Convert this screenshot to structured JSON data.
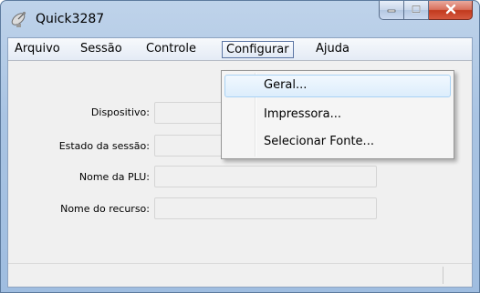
{
  "window": {
    "title": "Quick3287",
    "icon": "satellite-dish-icon",
    "buttons": {
      "minimize": "minimize-icon",
      "maximize": "maximize-icon",
      "close": "close-icon"
    }
  },
  "menubar": {
    "items": [
      {
        "label": "Arquivo"
      },
      {
        "label": "Sessão"
      },
      {
        "label": "Controle"
      },
      {
        "label": "Configurar"
      },
      {
        "label": "Ajuda"
      }
    ]
  },
  "form": {
    "fields": [
      {
        "label": "Dispositivo:",
        "value": ""
      },
      {
        "label": "Estado da sessão:",
        "value": ""
      },
      {
        "label": "Nome da PLU:",
        "value": ""
      },
      {
        "label": "Nome do recurso:",
        "value": ""
      }
    ]
  },
  "dropdown": {
    "open_menu": "Configurar",
    "items": [
      {
        "label": "Geral..."
      },
      {
        "label": "Impressora..."
      },
      {
        "label": "Selecionar Fonte..."
      }
    ]
  },
  "statusbar": {
    "text": ""
  },
  "colors": {
    "titlebar": "#a9c4e3",
    "close": "#c2391d",
    "highlight": "#dcedfc"
  }
}
